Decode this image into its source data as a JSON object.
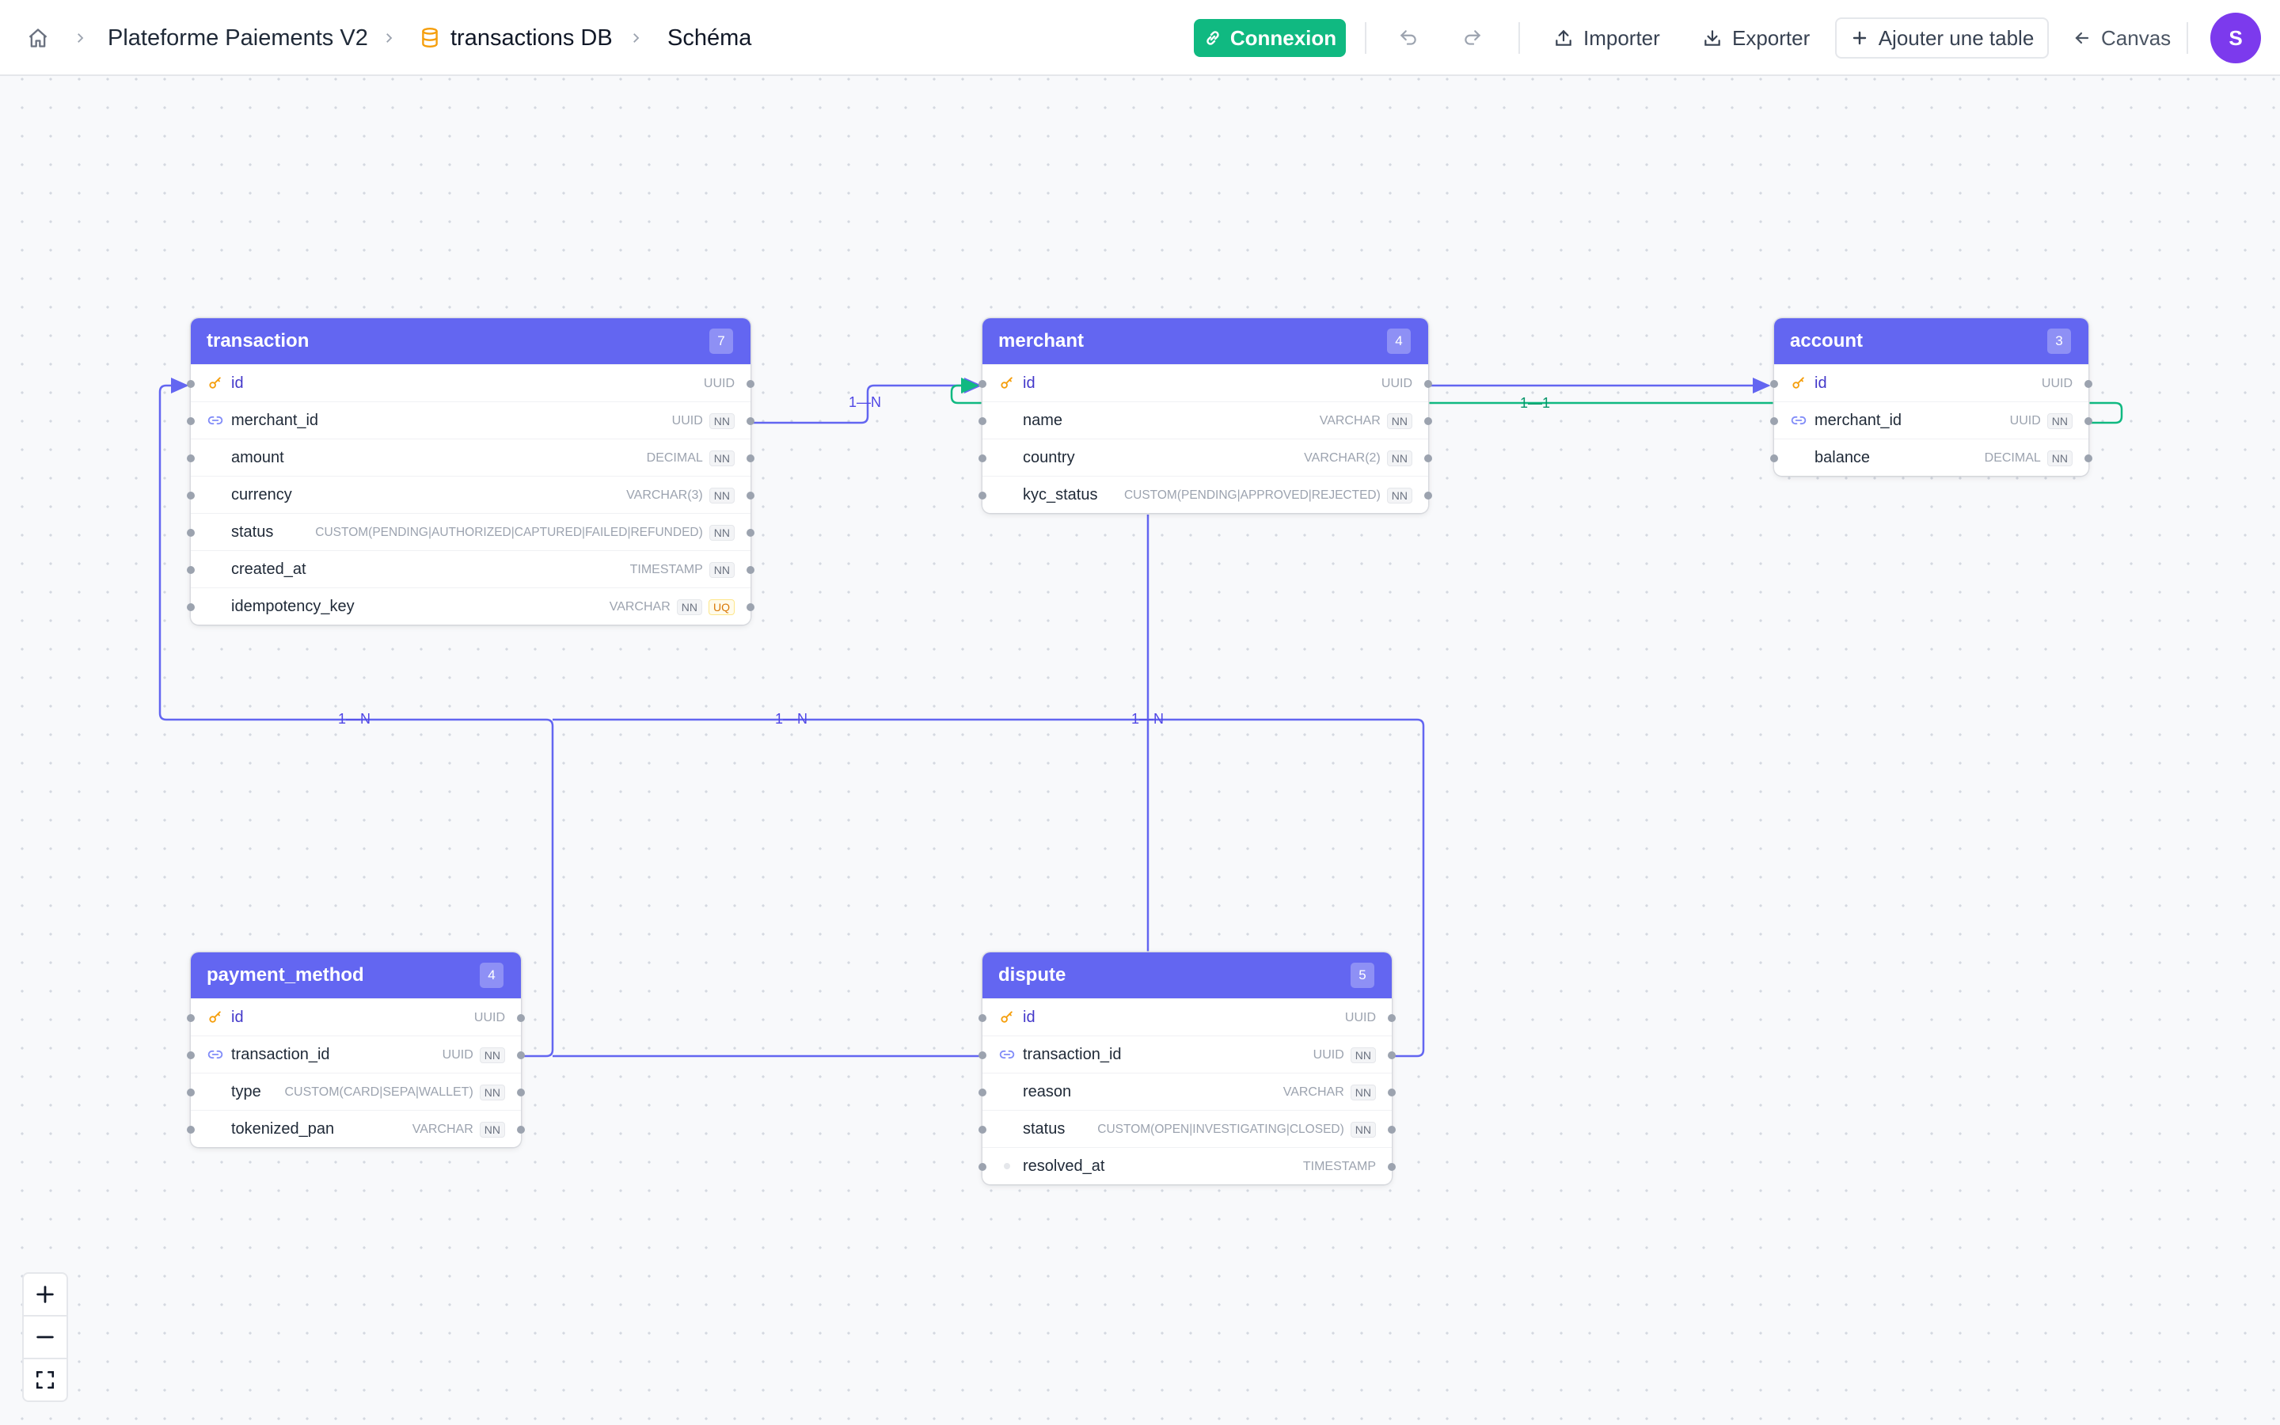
{
  "breadcrumb": {
    "home_icon": "home-icon",
    "project": "Plateforme Paiements V2",
    "database": "transactions DB",
    "page": "Schéma"
  },
  "toolbar": {
    "connect": "Connexion",
    "import": "Importer",
    "export": "Exporter",
    "add_table": "Ajouter une table",
    "canvas": "Canvas",
    "avatar": "S"
  },
  "colors": {
    "accent": "#6366f1",
    "success": "#10b981",
    "key": "#f59e0b",
    "avatar": "#7c3aed"
  },
  "tables": {
    "transaction": {
      "name": "transaction",
      "count": "7",
      "columns": [
        {
          "name": "id",
          "type": "UUID",
          "key": "pk"
        },
        {
          "name": "merchant_id",
          "type": "UUID",
          "nn": "NN",
          "key": "fk"
        },
        {
          "name": "amount",
          "type": "DECIMAL",
          "nn": "NN"
        },
        {
          "name": "currency",
          "type": "VARCHAR(3)",
          "nn": "NN"
        },
        {
          "name": "status",
          "type": "CUSTOM(PENDING|AUTHORIZED|CAPTURED|FAILED|REFUNDED)",
          "nn": "NN"
        },
        {
          "name": "created_at",
          "type": "TIMESTAMP",
          "nn": "NN"
        },
        {
          "name": "idempotency_key",
          "type": "VARCHAR",
          "nn": "NN",
          "uq": "UQ"
        }
      ]
    },
    "merchant": {
      "name": "merchant",
      "count": "4",
      "columns": [
        {
          "name": "id",
          "type": "UUID",
          "key": "pk"
        },
        {
          "name": "name",
          "type": "VARCHAR",
          "nn": "NN"
        },
        {
          "name": "country",
          "type": "VARCHAR(2)",
          "nn": "NN"
        },
        {
          "name": "kyc_status",
          "type": "CUSTOM(PENDING|APPROVED|REJECTED)",
          "nn": "NN"
        }
      ]
    },
    "account": {
      "name": "account",
      "count": "3",
      "columns": [
        {
          "name": "id",
          "type": "UUID",
          "key": "pk"
        },
        {
          "name": "merchant_id",
          "type": "UUID",
          "nn": "NN",
          "key": "fk"
        },
        {
          "name": "balance",
          "type": "DECIMAL",
          "nn": "NN"
        }
      ]
    },
    "payment_method": {
      "name": "payment_method",
      "count": "4",
      "columns": [
        {
          "name": "id",
          "type": "UUID",
          "key": "pk"
        },
        {
          "name": "transaction_id",
          "type": "UUID",
          "nn": "NN",
          "key": "fk"
        },
        {
          "name": "type",
          "type": "CUSTOM(CARD|SEPA|WALLET)",
          "nn": "NN"
        },
        {
          "name": "tokenized_pan",
          "type": "VARCHAR",
          "nn": "NN"
        }
      ]
    },
    "dispute": {
      "name": "dispute",
      "count": "5",
      "columns": [
        {
          "name": "id",
          "type": "UUID",
          "key": "pk"
        },
        {
          "name": "transaction_id",
          "type": "UUID",
          "nn": "NN",
          "key": "fk"
        },
        {
          "name": "reason",
          "type": "VARCHAR",
          "nn": "NN"
        },
        {
          "name": "status",
          "type": "CUSTOM(OPEN|INVESTIGATING|CLOSED)",
          "nn": "NN"
        },
        {
          "name": "resolved_at",
          "type": "TIMESTAMP"
        }
      ]
    }
  },
  "relations": {
    "transaction_merchant": "1—N",
    "merchant_account": "1—1",
    "payment_method_transaction": "1—N",
    "dispute_transaction": "1—N",
    "dispute_merchant": "1—N"
  },
  "zoom_controls": {
    "zoom_in_icon": "plus-icon",
    "zoom_out_icon": "minus-icon",
    "fit_icon": "fit-view-icon"
  }
}
